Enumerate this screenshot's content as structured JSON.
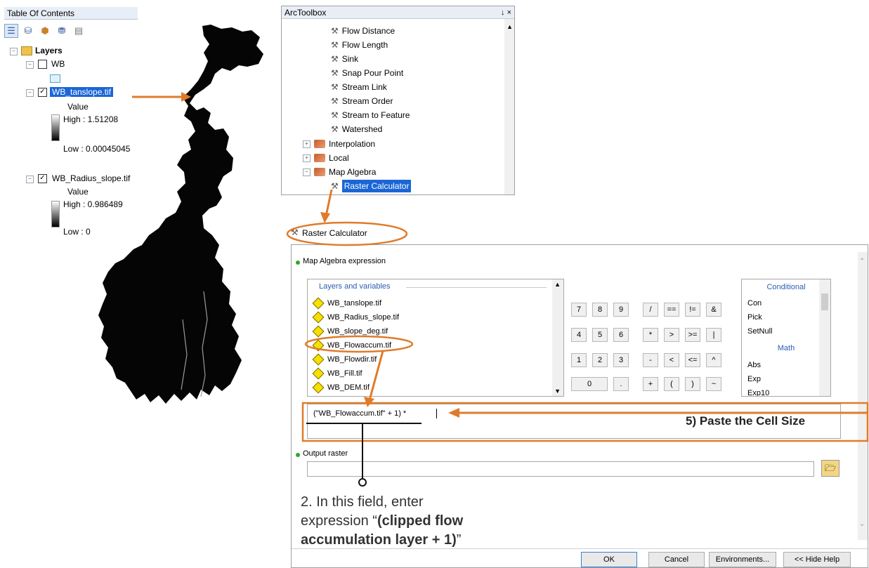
{
  "toc": {
    "title": "Table Of Contents",
    "root": "Layers",
    "layers": [
      {
        "name": "WB",
        "checked": false
      },
      {
        "name": "WB_tanslope.tif",
        "checked": true,
        "selected": true,
        "legend_title": "Value",
        "high": "High : 1.51208",
        "low": "Low : 0.00045045"
      },
      {
        "name": "WB_Radius_slope.tif",
        "checked": true,
        "legend_title": "Value",
        "high": "High : 0.986489",
        "low": "Low : 0"
      }
    ],
    "toolbar_icons": [
      "list-by-drawing-order-icon",
      "list-by-source-icon",
      "list-by-visibility-icon",
      "list-by-selection-icon",
      "options-icon"
    ]
  },
  "arctoolbox": {
    "title": "ArcToolbox",
    "pin": "↓ ×",
    "tools": [
      "Flow Distance",
      "Flow Length",
      "Sink",
      "Snap Pour Point",
      "Stream Link",
      "Stream Order",
      "Stream to Feature",
      "Watershed"
    ],
    "toolsets": [
      "Interpolation",
      "Local",
      "Map Algebra"
    ],
    "selected_tool": "Raster Calculator"
  },
  "raster_calculator": {
    "title": "Raster Calculator",
    "expr_label": "Map Algebra expression",
    "layers_header": "Layers and variables",
    "layers": [
      "WB_tanslope.tif",
      "WB_Radius_slope.tif",
      "WB_slope_deg.tif",
      "WB_Flowaccum.tif",
      "WB_Flowdir.tif",
      "WB_Fill.tif",
      "WB_DEM.tif"
    ],
    "keypad": [
      [
        "7",
        "8",
        "9",
        "/",
        "==",
        "!=",
        "&"
      ],
      [
        "4",
        "5",
        "6",
        "*",
        ">",
        ">=",
        "|"
      ],
      [
        "1",
        "2",
        "3",
        "-",
        "<",
        "<=",
        "^"
      ],
      [
        "0",
        ".",
        "+",
        "(",
        ")",
        "~"
      ]
    ],
    "groups": [
      {
        "name": "Conditional",
        "items": [
          "Con",
          "Pick",
          "SetNull"
        ]
      },
      {
        "name": "Math",
        "items": [
          "Abs",
          "Exp",
          "Exp10"
        ]
      }
    ],
    "expression": "(\"WB_Flowaccum.tif\" + 1) *",
    "output_label": "Output raster",
    "output_value": "",
    "buttons": {
      "ok": "OK",
      "cancel": "Cancel",
      "env": "Environments...",
      "help": "<< Hide Help"
    }
  },
  "annotations": {
    "paste": "5) Paste the Cell Size",
    "note_line1": "2. In this field, enter",
    "note_line2_a": "expression “",
    "note_line2_b": "(clipped flow",
    "note_line3_a": "accumulation layer + 1)",
    "note_line3_b": "”"
  },
  "colors": {
    "accent": "#e07b2a",
    "selection": "#1a66d6",
    "group_header": "#2a5db0"
  }
}
